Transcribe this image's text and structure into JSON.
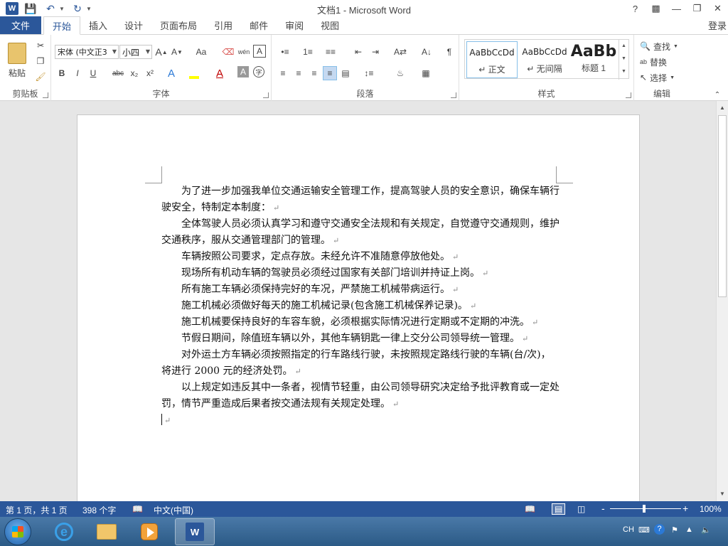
{
  "titlebar": {
    "app_title": "文档1 - Microsoft Word",
    "help": "?",
    "icons": [
      "word-logo-icon",
      "save-icon",
      "undo-icon",
      "redo-icon",
      "customize-qat-icon"
    ]
  },
  "tabs": {
    "file": "文件",
    "items": [
      "开始",
      "插入",
      "设计",
      "页面布局",
      "引用",
      "邮件",
      "审阅",
      "视图"
    ],
    "active": "开始",
    "login": "登录"
  },
  "ribbon": {
    "clipboard": {
      "label": "剪贴板",
      "paste": "粘贴"
    },
    "font": {
      "label": "字体",
      "font_name": "宋体 (中文正3",
      "font_size": "小四",
      "change_case": "Aa",
      "bold": "B",
      "italic": "I",
      "underline": "U",
      "strike": "abc",
      "sub": "x₂",
      "sup": "x²",
      "pinyin": "wén",
      "border_char": "A"
    },
    "paragraph": {
      "label": "段落"
    },
    "styles": {
      "label": "样式",
      "items": [
        {
          "sample": "AaBbCcDd",
          "name": "↵ 正文"
        },
        {
          "sample": "AaBbCcDd",
          "name": "↵ 无间隔"
        },
        {
          "sample": "AaBb",
          "name": "标题 1"
        }
      ]
    },
    "editing": {
      "label": "编辑",
      "find": "查找",
      "replace": "替换",
      "select": "选择"
    }
  },
  "document": {
    "paragraphs": [
      "为了进一步加强我单位交通运输安全管理工作，提高驾驶人员的安全意识，确保车辆行驶安全，特制定本制度：",
      "全体驾驶人员必须认真学习和遵守交通安全法规和有关规定，自觉遵守交通规则，维护交通秩序，服从交通管理部门的管理。",
      "车辆按照公司要求，定点存放。未经允许不准随意停放他处。",
      "现场所有机动车辆的驾驶员必须经过国家有关部门培训并持证上岗。",
      "所有施工车辆必须保持完好的车况，严禁施工机械带病运行。",
      "施工机械必须做好每天的施工机械记录(包含施工机械保养记录)。",
      "施工机械要保持良好的车容车貌，必须根据实际情况进行定期或不定期的冲洗。",
      "节假日期间，除值班车辆以外，其他车辆钥匙一律上交分公司领导统一管理。",
      "对外运土方车辆必须按照指定的行车路线行驶，未按照规定路线行驶的车辆(台/次)，将进行 2000 元的经济处罚。",
      "以上规定如违反其中一条者，视情节轻重，由公司领导研究决定给予批评教育或一定处罚，情节严重造成后果者按交通法规有关规定处理。"
    ],
    "para_mark": "↵"
  },
  "statusbar": {
    "page": "第 1 页，共 1 页",
    "words": "398 个字",
    "language": "中文(中国)",
    "zoom": "100%",
    "zoom_minus": "-",
    "zoom_plus": "+"
  },
  "taskbar": {
    "tray_lang": "CH"
  }
}
